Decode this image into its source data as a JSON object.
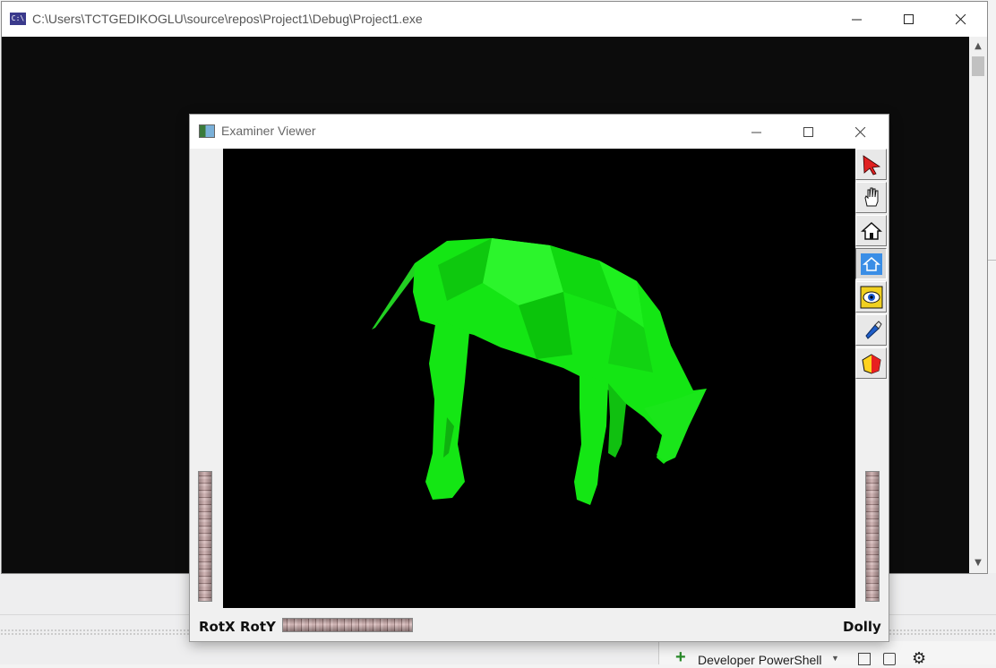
{
  "console_window": {
    "title": "C:\\Users\\TCTGEDIKOGLU\\source\\repos\\Project1\\Debug\\Project1.exe",
    "icon": "C:\\"
  },
  "examiner_window": {
    "title": "Examiner Viewer",
    "labels": {
      "rotx": "RotX",
      "roty": "RotY",
      "dolly": "Dolly"
    },
    "tools": [
      {
        "name": "pick-arrow-icon",
        "active": false
      },
      {
        "name": "view-hand-icon",
        "active": false
      },
      {
        "name": "home-icon",
        "active": false
      },
      {
        "name": "set-home-icon",
        "active": true
      },
      {
        "name": "view-all-icon",
        "active": false
      },
      {
        "name": "seek-icon",
        "active": false
      },
      {
        "name": "projection-icon",
        "active": false
      }
    ],
    "model_color": "#00ff00"
  },
  "ide": {
    "powershell_label": "Developer PowerShell"
  }
}
